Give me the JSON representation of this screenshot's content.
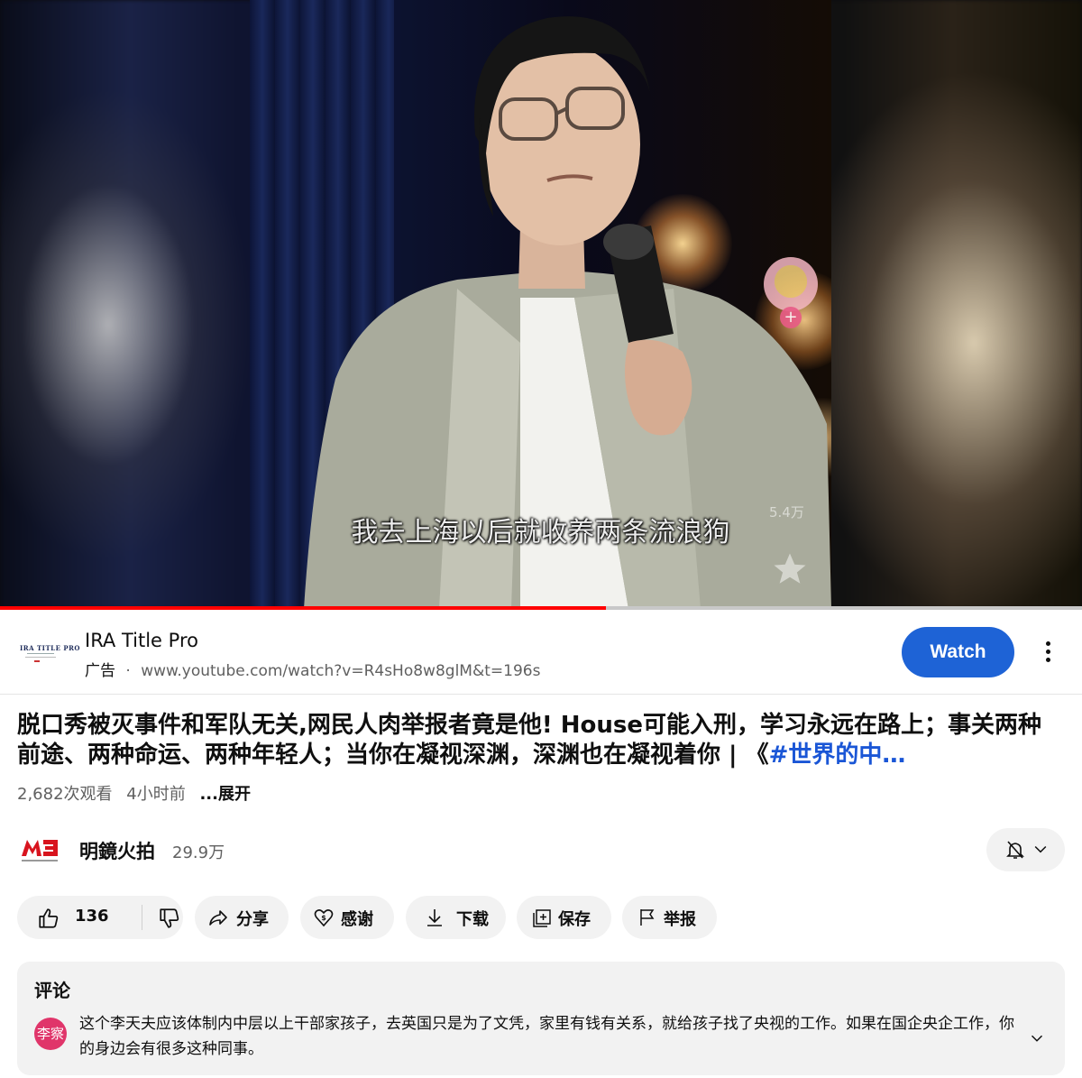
{
  "player": {
    "subtitle": "我去上海以后就收养两条流浪狗",
    "side_count": "5.4万",
    "progress": 0.56
  },
  "ad": {
    "title": "IRA Title Pro",
    "tag": "广告",
    "separator": "·",
    "url": "www.youtube.com/watch?v=R4sHo8w8glM&t=196s",
    "logo_text": "IRA TITLE PRO",
    "watch_label": "Watch"
  },
  "video": {
    "title_main": "脱口秀被灭事件和军队无关,网民人肉举报者竟是他! House可能入刑，学习永远在路上；事关两种前途、两种命运、两种年轻人；当你在凝视深渊，深渊也在凝视着你 | 《",
    "title_hashtag": "#世界的中…",
    "views": "2,682次观看",
    "time_ago": "4小时前",
    "expand_label": "...展开"
  },
  "channel": {
    "name": "明鏡火拍",
    "subscribers": "29.9万"
  },
  "actions": {
    "like_count": "136",
    "share": "分享",
    "thanks": "感谢",
    "download": "下载",
    "save": "保存",
    "report": "举报"
  },
  "comments": {
    "title": "评论",
    "avatar_text": "李察",
    "text": "这个李天夫应该体制内中层以上干部家孩子，去英国只是为了文凭，家里有钱有关系，就给孩子找了央视的工作。如果在国企央企工作，你的身边会有很多这种同事。"
  },
  "colors": {
    "watch_button": "#1e63d6",
    "hashtag": "#1a56d6",
    "progress": "#ff0000",
    "avatar": "#e0356a",
    "chip_bg": "#f2f2f2"
  },
  "icons": [
    "like-icon",
    "dislike-icon",
    "share-icon",
    "thanks-icon",
    "download-icon",
    "save-icon",
    "report-icon",
    "bell-off-icon",
    "chevron-down-icon",
    "more-vert-icon"
  ]
}
